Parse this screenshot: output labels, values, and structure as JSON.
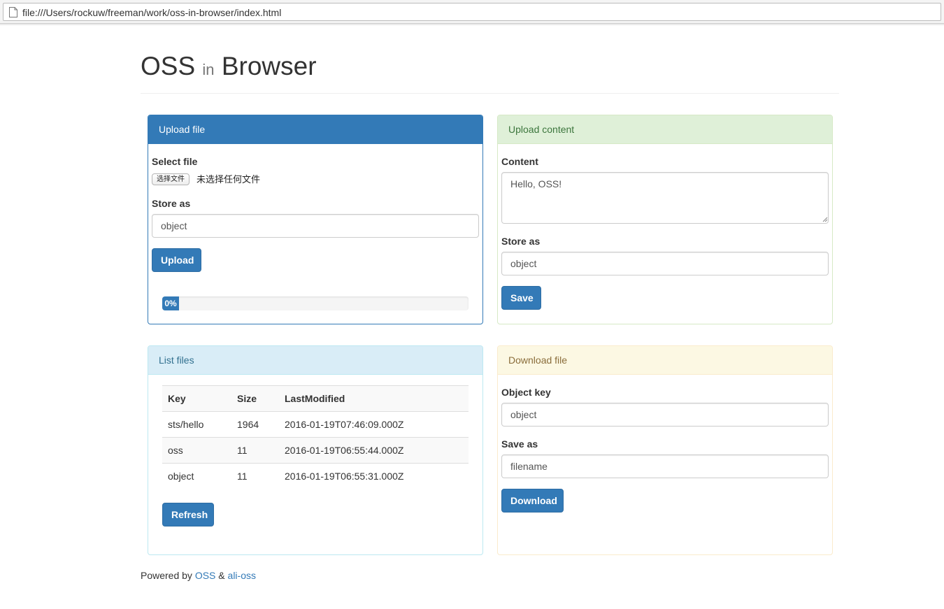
{
  "browser": {
    "url": "file:///Users/rockuw/freeman/work/oss-in-browser/index.html"
  },
  "header": {
    "title_part1": "OSS",
    "title_small": "in",
    "title_part2": "Browser"
  },
  "upload_file": {
    "heading": "Upload file",
    "select_label": "Select file",
    "choose_button": "选择文件",
    "no_file_text": "未选择任何文件",
    "store_as_label": "Store as",
    "store_as_value": "object",
    "upload_button": "Upload",
    "progress_text": "0%",
    "progress_percent": 0
  },
  "upload_content": {
    "heading": "Upload content",
    "content_label": "Content",
    "content_value": "Hello, OSS!",
    "store_as_label": "Store as",
    "store_as_value": "object",
    "save_button": "Save"
  },
  "list_files": {
    "heading": "List files",
    "columns": [
      "Key",
      "Size",
      "LastModified"
    ],
    "rows": [
      {
        "key": "sts/hello",
        "size": "1964",
        "modified": "2016-01-19T07:46:09.000Z"
      },
      {
        "key": "oss",
        "size": "11",
        "modified": "2016-01-19T06:55:44.000Z"
      },
      {
        "key": "object",
        "size": "11",
        "modified": "2016-01-19T06:55:31.000Z"
      }
    ],
    "refresh_button": "Refresh"
  },
  "download_file": {
    "heading": "Download file",
    "object_key_label": "Object key",
    "object_key_value": "object",
    "save_as_label": "Save as",
    "save_as_value": "filename",
    "download_button": "Download"
  },
  "footer": {
    "prefix": "Powered by",
    "link1": "OSS",
    "separator": "&",
    "link2": "ali-oss"
  },
  "colors": {
    "primary": "#337ab7",
    "success_bg": "#dff0d8",
    "info_bg": "#d9edf7",
    "warning_bg": "#fcf8e3"
  }
}
